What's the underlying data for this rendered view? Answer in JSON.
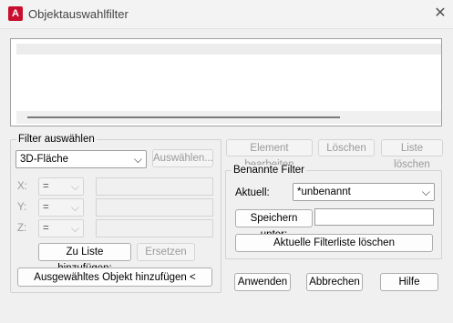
{
  "window": {
    "title": "Objektauswahlfilter",
    "app_icon_letter": "A"
  },
  "filter_select": {
    "group_label": "Filter auswählen",
    "selected_value": "3D-Fläche",
    "select_button": "Auswählen...",
    "x_label": "X:",
    "y_label": "Y:",
    "z_label": "Z:",
    "x_operator": "=",
    "y_operator": "=",
    "z_operator": "=",
    "add_to_list_button": "Zu Liste hinzufügen:",
    "replace_button": "Ersetzen",
    "add_selected_button": "Ausgewähltes Objekt hinzufügen <"
  },
  "list_actions": {
    "edit_button": "Element bearbeiten",
    "delete_button": "Löschen",
    "clear_list_button": "Liste löschen"
  },
  "named_filters": {
    "group_label": "Benannte Filter",
    "current_label": "Aktuell:",
    "current_value": "*unbenannt",
    "save_as_button": "Speichern unter:",
    "save_as_value": "",
    "delete_list_button": "Aktuelle Filterliste löschen"
  },
  "footer": {
    "apply_button": "Anwenden",
    "cancel_button": "Abbrechen",
    "help_button": "Hilfe"
  }
}
